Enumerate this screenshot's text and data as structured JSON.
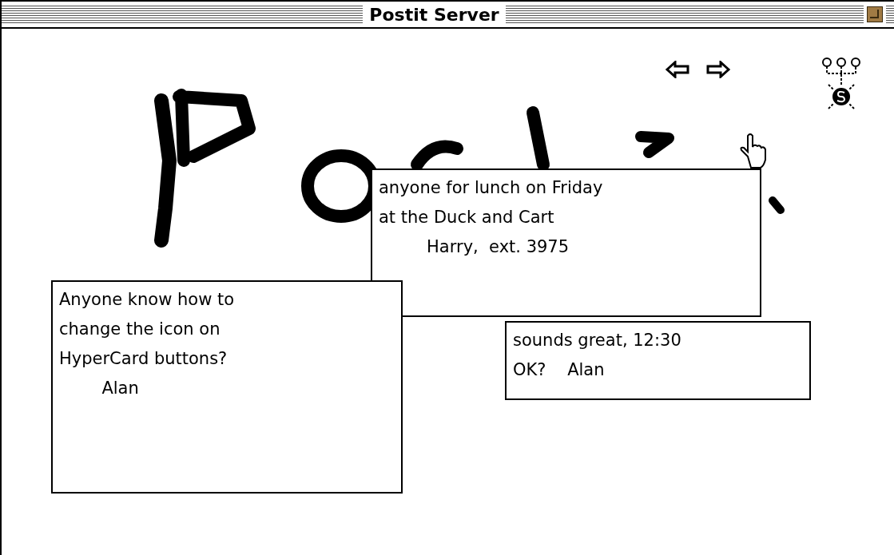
{
  "window": {
    "title": "Postit Server"
  },
  "notes": [
    {
      "text": "anyone for lunch on Friday\nat the Duck and Cart\n         Harry,  ext. 3975"
    },
    {
      "text": "Anyone know how to\nchange the icon on\nHyperCard buttons?\n        Alan"
    },
    {
      "text": "sounds great, 12:30\nOK?    Alan"
    }
  ]
}
